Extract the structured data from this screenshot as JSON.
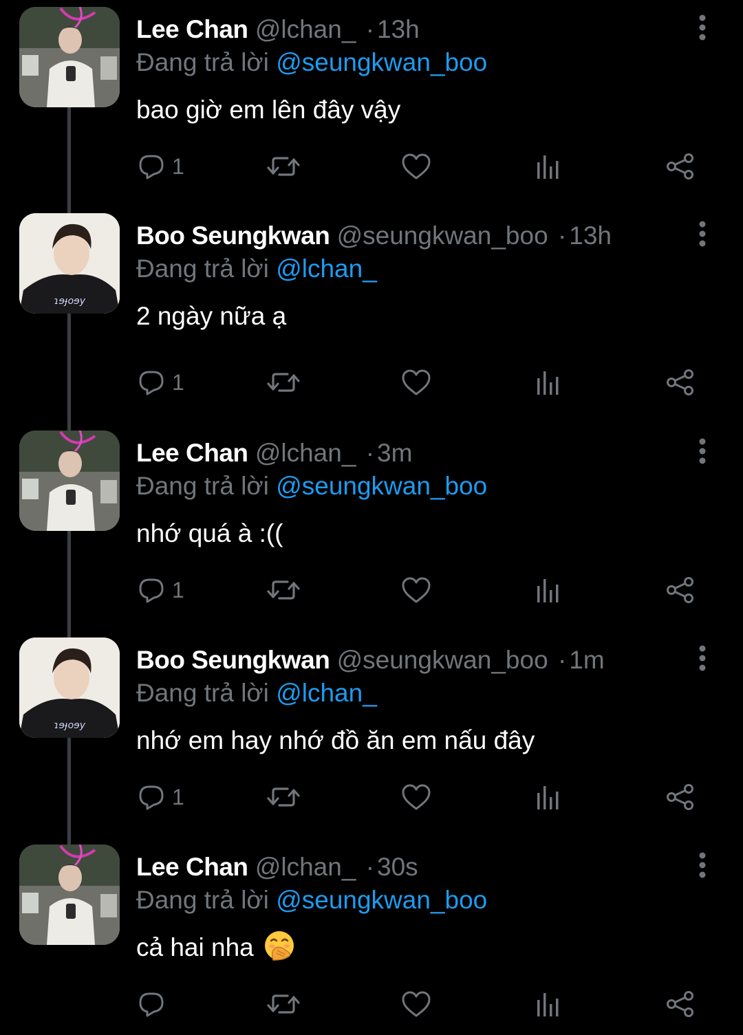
{
  "colors": {
    "background": "#000000",
    "name": "#ffffff",
    "muted": "#71767b",
    "mention": "#1d9bf0",
    "thread_line": "#3a3f44"
  },
  "icons": {
    "reply": "reply-icon",
    "retweet": "retweet-icon",
    "like": "like-icon",
    "views": "views-icon",
    "share": "share-icon",
    "more": "more-icon"
  },
  "tweets": [
    {
      "name": "Lee Chan",
      "handle": "@lchan_",
      "separator": "·",
      "time": "13h",
      "replying_label": "Đang trả lời",
      "replying_to": "@seungkwan_boo",
      "text": "bao giờ em lên đây vậy",
      "reply_count": "1",
      "avatar": "lee-chan"
    },
    {
      "name": "Boo Seungkwan",
      "handle": "@seungkwan_boo",
      "separator": "·",
      "time": "13h",
      "replying_label": "Đang trả lời",
      "replying_to": "@lchan_",
      "text": "2 ngày nữa ạ",
      "reply_count": "1",
      "avatar": "boo-seungkwan"
    },
    {
      "name": "Lee Chan",
      "handle": "@lchan_",
      "separator": "·",
      "time": "3m",
      "replying_label": "Đang trả lời",
      "replying_to": "@seungkwan_boo",
      "text": "nhớ quá à :((",
      "reply_count": "1",
      "avatar": "lee-chan"
    },
    {
      "name": "Boo Seungkwan",
      "handle": "@seungkwan_boo",
      "separator": "·",
      "time": "1m",
      "replying_label": "Đang trả lời",
      "replying_to": "@lchan_",
      "text": "nhớ em hay nhớ đồ ăn em nấu đây",
      "reply_count": "1",
      "avatar": "boo-seungkwan"
    },
    {
      "name": "Lee Chan",
      "handle": "@lchan_",
      "separator": "·",
      "time": "30s",
      "replying_label": "Đang trả lời",
      "replying_to": "@seungkwan_boo",
      "text": "cả hai nha",
      "emoji": "face-with-hand-over-mouth",
      "reply_count": "",
      "avatar": "lee-chan"
    }
  ]
}
